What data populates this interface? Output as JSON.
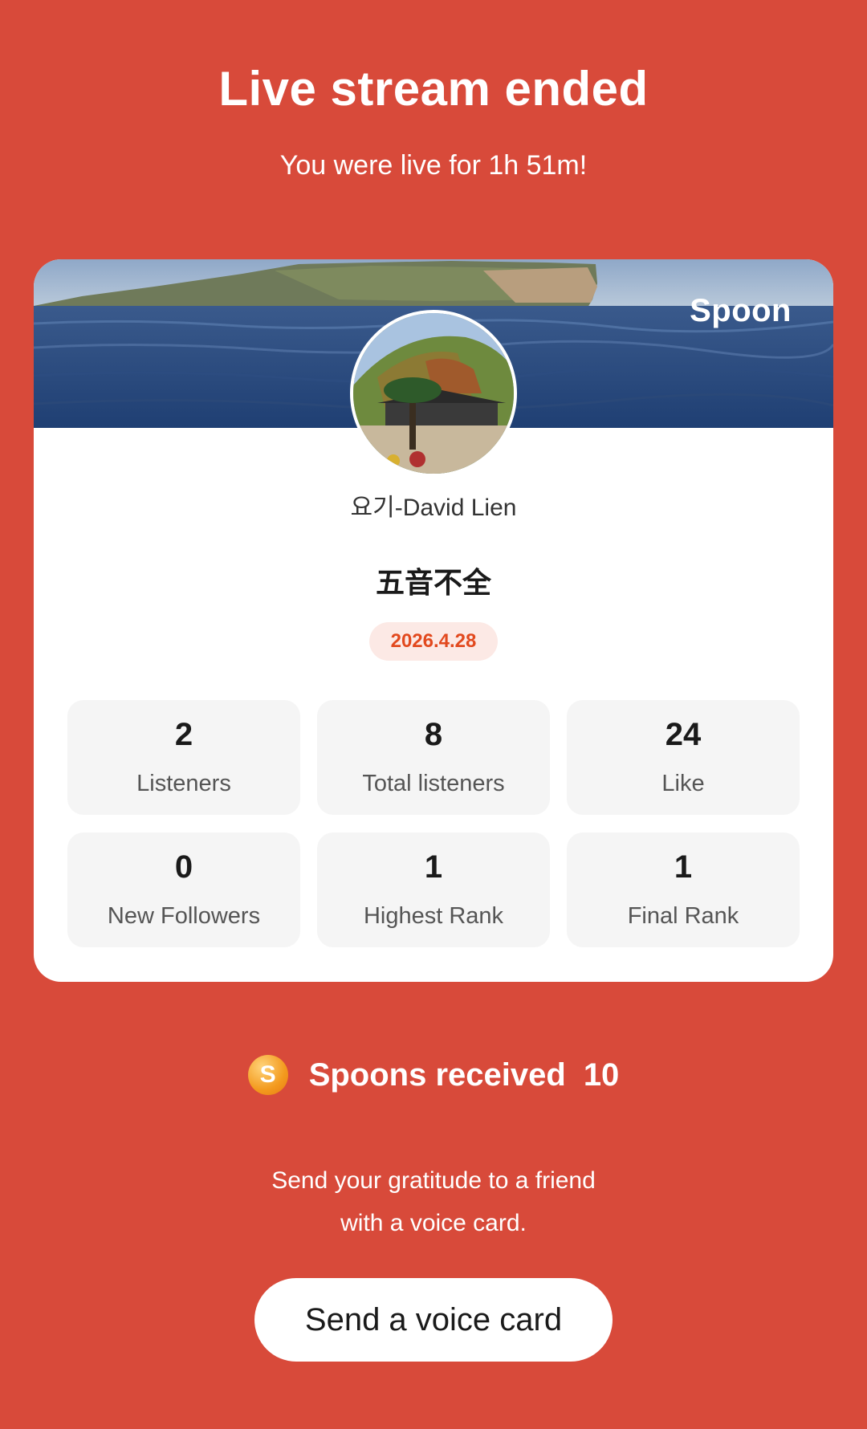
{
  "header": {
    "title": "Live stream ended",
    "subtitle": "You were live for 1h 51m!"
  },
  "card": {
    "brand": "Spoon",
    "host_name": "요기-David Lien",
    "live_title": "五音不全",
    "date": "2026.4.28",
    "stats": [
      {
        "value": "2",
        "label": "Listeners"
      },
      {
        "value": "8",
        "label": "Total listeners"
      },
      {
        "value": "24",
        "label": "Like"
      },
      {
        "value": "0",
        "label": "New Followers"
      },
      {
        "value": "1",
        "label": "Highest Rank"
      },
      {
        "value": "1",
        "label": "Final Rank"
      }
    ]
  },
  "spoons": {
    "icon": "spoon-coin-icon",
    "icon_glyph": "S",
    "label": "Spoons received",
    "count": "10"
  },
  "gratitude": {
    "line1": "Send your gratitude to a friend",
    "line2": "with a voice card."
  },
  "actions": {
    "voice_card_label": "Send a voice card"
  },
  "colors": {
    "background": "#D84A3A",
    "date_badge_bg": "#FCE9E5",
    "date_badge_text": "#E2491E",
    "stat_tile_bg": "#F5F5F5"
  }
}
